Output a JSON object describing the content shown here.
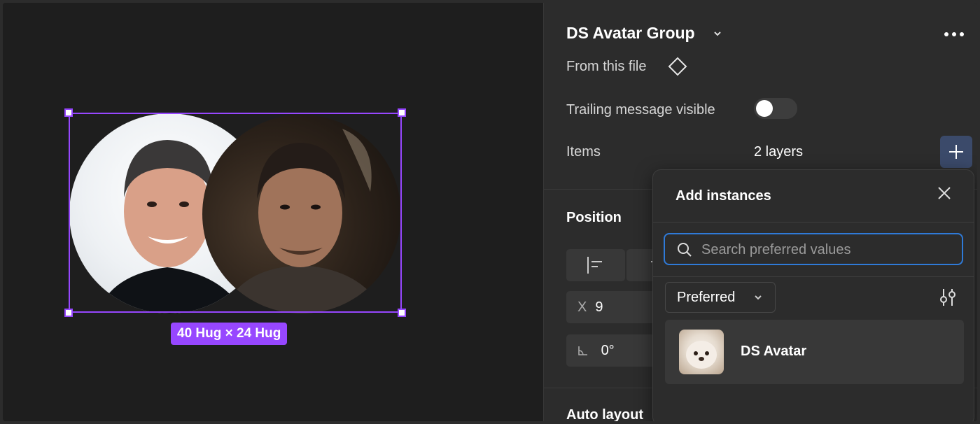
{
  "canvas": {
    "selection_label": "40 Hug × 24 Hug"
  },
  "panel": {
    "title": "DS Avatar Group",
    "source_label": "From this file",
    "trailing_label": "Trailing message visible",
    "trailing_visible": false,
    "items_label": "Items",
    "items_value": "2 layers",
    "position_heading": "Position",
    "x_prefix": "X",
    "x_value": "9",
    "rotation_value": "0°",
    "autolayout_heading": "Auto layout"
  },
  "popover": {
    "title": "Add instances",
    "search_placeholder": "Search preferred values",
    "filter_label": "Preferred",
    "items": [
      {
        "name": "DS Avatar"
      }
    ]
  },
  "colors": {
    "selection": "#9747ff",
    "focus": "#2f7ad8",
    "accent_button": "#3b4a6a"
  },
  "icons": [
    "chevron-down-icon",
    "more-icon",
    "component-diamond-icon",
    "plus-icon",
    "close-icon",
    "search-icon",
    "filter-icon",
    "align-left-icon",
    "rotation-icon"
  ]
}
